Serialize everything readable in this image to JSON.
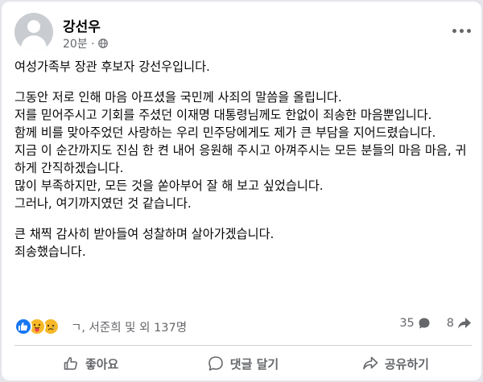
{
  "post": {
    "author": "강선우",
    "timestamp": "20분 ·",
    "audience_icon": "globe-icon",
    "paragraphs": [
      [
        "여성가족부 장관 후보자 강선우입니다."
      ],
      [
        "그동안 저로 인해 마음 아프셨을 국민께 사죄의 말씀을 올립니다.",
        "저를 믿어주시고 기회를 주셨던 이재명 대통령님께도 한없이 죄송한 마음뿐입니다.",
        "함께 비를 맞아주었던 사랑하는 우리 민주당에게도 제가 큰 부담을 지어드렸습니다.",
        "지금 이 순간까지도 진심 한 켠 내어 응원해 주시고 아껴주시는 모든 분들의 마음 마음, 귀하게 간직하겠습니다.",
        "많이 부족하지만, 모든 것을 쏟아부어 잘 해 보고 싶었습니다.",
        "그러나, 여기까지였던 것 같습니다."
      ],
      [
        "큰 채찍 감사히 받아들여 성찰하며 살아가겠습니다.",
        "죄송했습니다."
      ]
    ]
  },
  "reactions": {
    "icons": [
      "like-reaction-icon",
      "care-reaction-icon",
      "sad-reaction-icon"
    ],
    "names_text": "ㄱ, 서준희 및 외 137명",
    "comment_count": "35",
    "share_count": "8"
  },
  "actions": {
    "like_label": "좋아요",
    "comment_label": "댓글 달기",
    "share_label": "공유하기"
  },
  "colors": {
    "text": "#050505",
    "secondary": "#65676b",
    "like_blue": "#1877f2",
    "sad_yellow": "#f7b928",
    "care_red": "#f33e58"
  }
}
